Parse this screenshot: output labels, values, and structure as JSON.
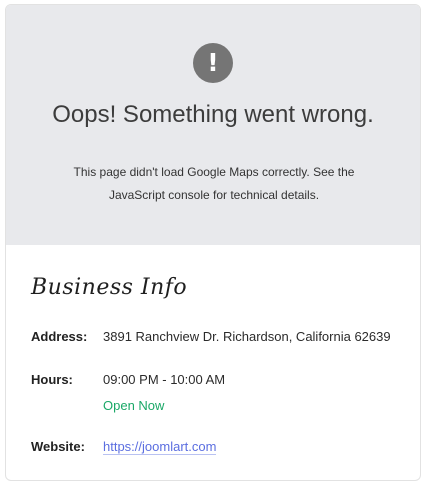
{
  "map_error": {
    "icon": "exclamation-icon",
    "icon_glyph": "!",
    "title": "Oops! Something went wrong.",
    "message": "This page didn't load Google Maps correctly. See the JavaScript console for technical details."
  },
  "business_info": {
    "heading": "Business Info",
    "address_label": "Address:",
    "address": "3891 Ranchview Dr. Richardson, California 62639",
    "hours_label": "Hours:",
    "hours": "09:00 PM - 10:00 AM",
    "status": "Open Now",
    "status_color": "#1aa867",
    "website_label": "Website:",
    "website": "https://joomlart.com"
  }
}
